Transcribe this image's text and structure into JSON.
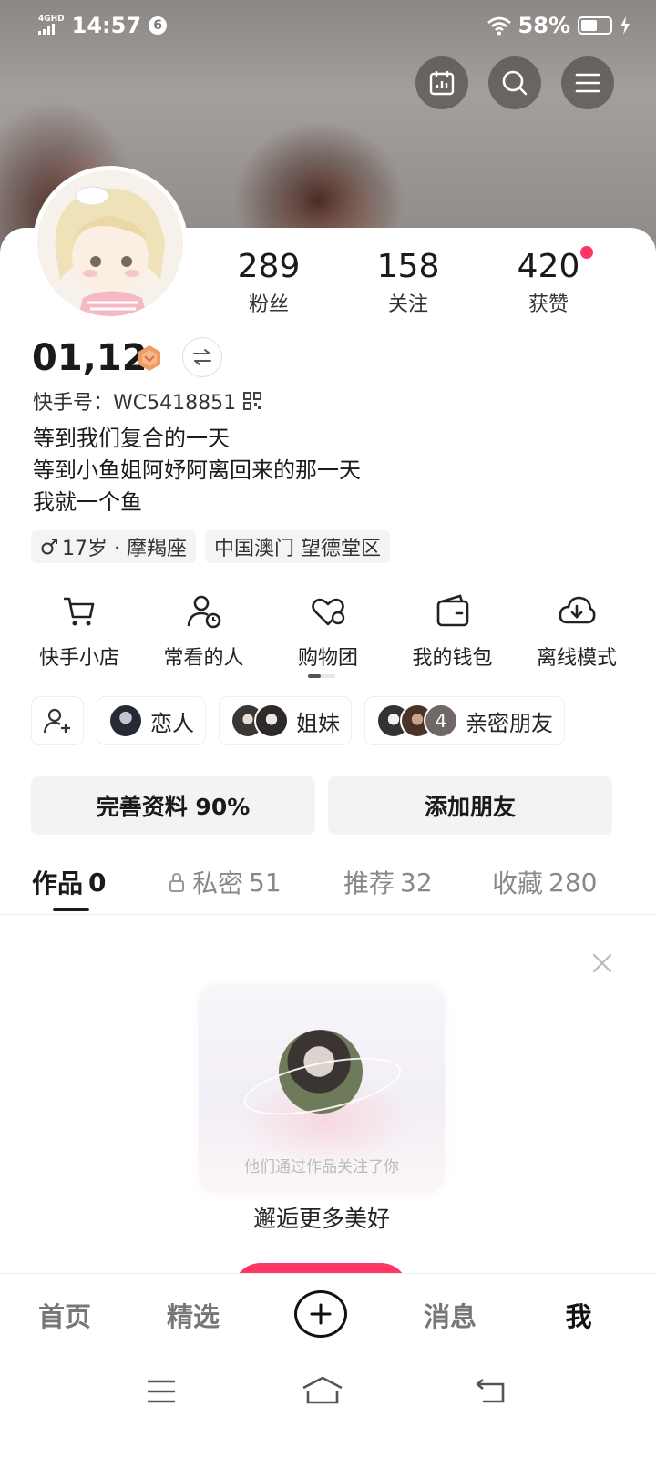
{
  "status_bar": {
    "network": "4GHD",
    "time": "14:57",
    "notification_badge": "6",
    "battery_percent": "58%",
    "battery_level": 0.58
  },
  "top_actions": {
    "calendar_icon": "calendar-chart-icon",
    "search_icon": "search-icon",
    "menu_icon": "menu-icon"
  },
  "profile": {
    "stats": [
      {
        "value": "289",
        "label": "粉丝"
      },
      {
        "value": "158",
        "label": "关注"
      },
      {
        "value": "420",
        "label": "获赞"
      }
    ],
    "name": "01,12",
    "id_label": "快手号：WC5418851",
    "bio": [
      "等到我们复合的一天",
      "等到小鱼姐阿妤阿离回来的那一天",
      "我就一个鱼"
    ],
    "tags": [
      "17岁 · 摩羯座",
      "中国澳门 望德堂区"
    ]
  },
  "shortcuts": [
    {
      "label": "快手小店",
      "icon": "cart-icon"
    },
    {
      "label": "常看的人",
      "icon": "user-clock-icon"
    },
    {
      "label": "购物团",
      "icon": "heart-group-icon"
    },
    {
      "label": "我的钱包",
      "icon": "wallet-icon"
    },
    {
      "label": "离线模式",
      "icon": "cloud-download-icon"
    }
  ],
  "relations": [
    {
      "label": "恋人"
    },
    {
      "label": "姐妹"
    },
    {
      "label": "亲密朋友",
      "count": "4"
    }
  ],
  "actions": {
    "complete_profile": "完善资料 90%",
    "add_friend": "添加朋友"
  },
  "tabs": [
    {
      "label": "作品",
      "count": "0"
    },
    {
      "label": "私密",
      "count": "51"
    },
    {
      "label": "推荐",
      "count": "32"
    },
    {
      "label": "收藏",
      "count": "280"
    }
  ],
  "promo": {
    "caption": "他们通过作品关注了你",
    "title": "邂逅更多美好"
  },
  "bottom_nav": [
    "首页",
    "精选",
    "消息",
    "我"
  ]
}
